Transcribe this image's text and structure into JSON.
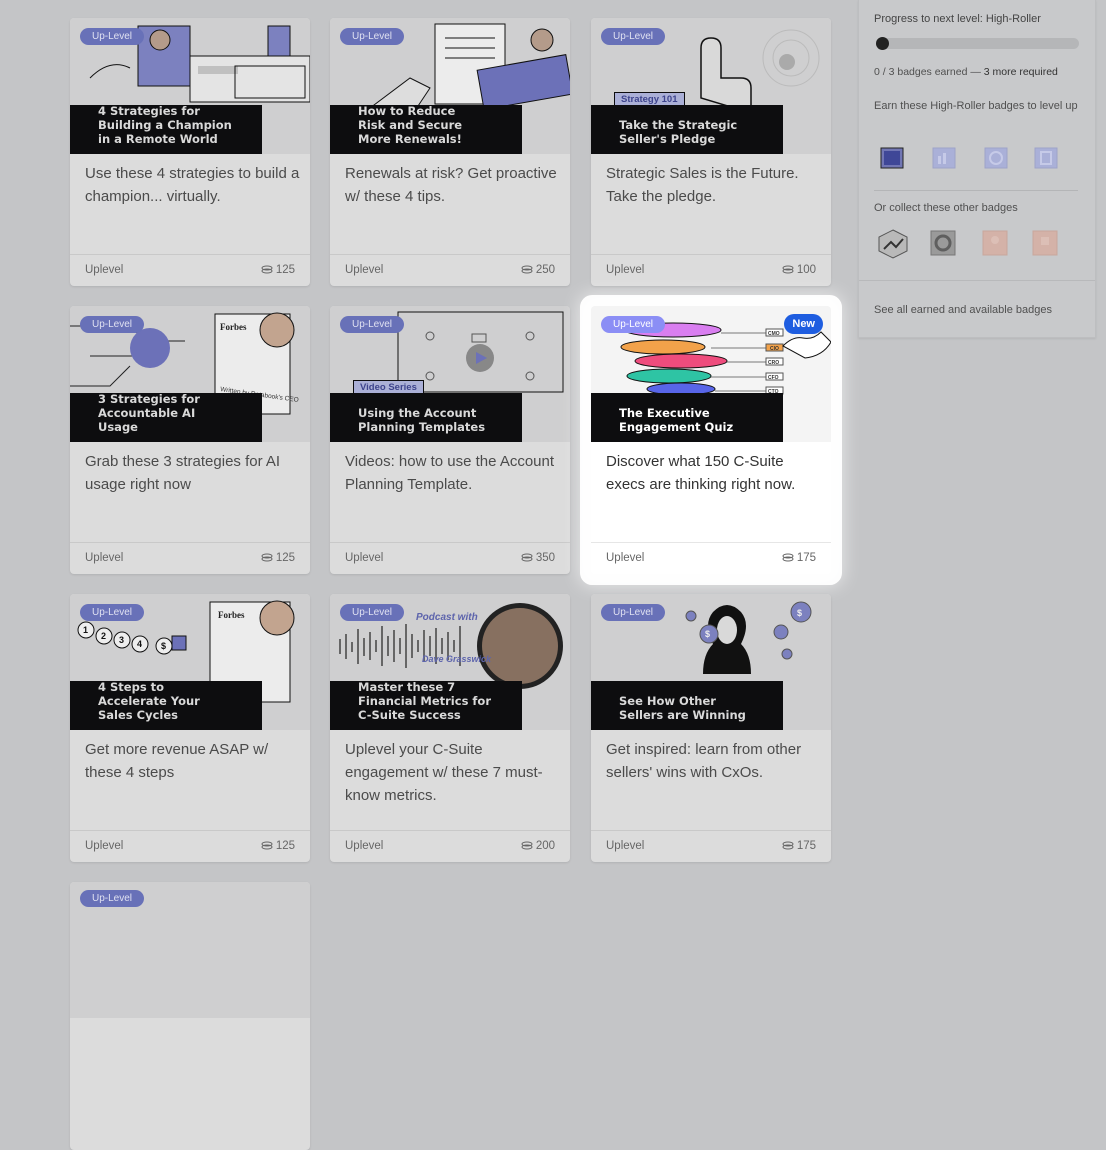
{
  "panel": {
    "progress_label": "Progress to next level: High-Roller",
    "progress_fraction": 0.0,
    "badges_earned": "0 / 3 badges earned — ",
    "badges_required": "3 more required",
    "earn_heading": "Earn these High-Roller badges to level up",
    "collect_heading": "Or collect these other badges",
    "see_all_link": "See all earned and available badges",
    "earn_badges": [
      "book-badge-icon",
      "chart-badge-icon",
      "target-badge-icon",
      "checklist-badge-icon"
    ],
    "other_badges": [
      "trend-badge-icon",
      "gear-badge-icon",
      "people-badge-icon",
      "flag-badge-icon"
    ]
  },
  "cards": [
    {
      "pill": "Up-Level",
      "title": "4 Strategies for\nBuilding a Champion\nin a Remote World",
      "tag": "",
      "desc": "Use these 4 strategies to build a champion... virtually.",
      "brand": "Uplevel",
      "points": "125",
      "new": ""
    },
    {
      "pill": "Up-Level",
      "title": "How to Reduce\nRisk and Secure\nMore Renewals!",
      "tag": "",
      "desc": "Renewals at risk? Get proactive w/ these 4 tips.",
      "brand": "Uplevel",
      "points": "250",
      "new": ""
    },
    {
      "pill": "Up-Level",
      "title": "Take the Strategic\nSeller's Pledge",
      "tag": "Strategy 101",
      "desc": "Strategic Sales is the Future. Take the pledge.",
      "brand": "Uplevel",
      "points": "100",
      "new": ""
    },
    {
      "pill": "Up-Level",
      "title": "3 Strategies for\nAccountable AI\nUsage",
      "tag": "",
      "desc": "Grab these 3 strategies for AI usage right now",
      "brand": "Uplevel",
      "points": "125",
      "new": ""
    },
    {
      "pill": "Up-Level",
      "title": "Using the Account\nPlanning Templates",
      "tag": "Video Series",
      "desc": "Videos: how to use the Account Planning Template.",
      "brand": "Uplevel",
      "points": "350",
      "new": ""
    },
    {
      "pill": "Up-Level",
      "title": "The Executive\nEngagement Quiz",
      "tag": "",
      "desc": "Discover what 150 C-Suite execs are thinking right now.",
      "brand": "Uplevel",
      "points": "175",
      "new": "New"
    },
    {
      "pill": "Up-Level",
      "title": "4 Steps to\nAccelerate Your\nSales Cycles",
      "tag": "",
      "desc": "Get more revenue ASAP w/ these 4 steps",
      "brand": "Uplevel",
      "points": "125",
      "new": ""
    },
    {
      "pill": "Up-Level",
      "title": "Master these 7\nFinancial Metrics for\nC-Suite Success",
      "tag": "",
      "desc": "Uplevel your C-Suite engagement w/ these 7 must-know metrics.",
      "brand": "Uplevel",
      "points": "200",
      "new": ""
    },
    {
      "pill": "Up-Level",
      "title": "See How Other\nSellers are Winning",
      "tag": "",
      "desc": "Get inspired: learn from other sellers' wins with CxOs.",
      "brand": "Uplevel",
      "points": "175",
      "new": ""
    },
    {
      "pill": "Up-Level",
      "title": "",
      "tag": "",
      "desc": "",
      "brand": "",
      "points": "",
      "new": ""
    }
  ],
  "art_text": {
    "forbes": "Forbes",
    "podcast_with": "Podcast with",
    "podcast_guest": "Dave Grasswick",
    "written_by": "Written by Databook's CEO Anand Shah",
    "quiz_roles": [
      "CMO",
      "CIO",
      "CRO",
      "CFO",
      "CTO"
    ]
  },
  "colors": {
    "pill": "#6670c4",
    "new_badge": "#1e5de0",
    "title_block": "#0d0d0f",
    "overlay_bg": "#c4c5c7"
  }
}
